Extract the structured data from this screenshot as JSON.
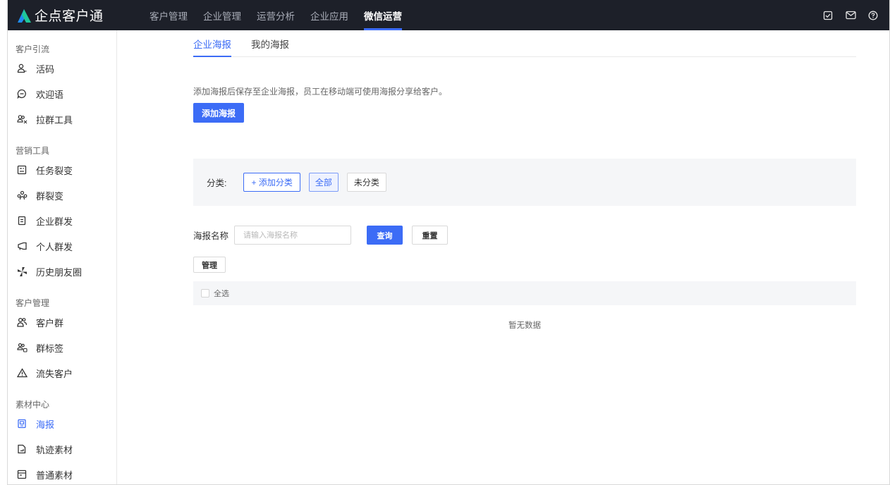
{
  "app": {
    "title": "企点客户通"
  },
  "topnav": {
    "items": [
      {
        "label": "客户管理"
      },
      {
        "label": "企业管理"
      },
      {
        "label": "运营分析"
      },
      {
        "label": "企业应用"
      },
      {
        "label": "微信运营"
      }
    ],
    "active_index": 4
  },
  "sidebar": {
    "groups": [
      {
        "label": "客户引流",
        "items": [
          {
            "label": "活码",
            "icon": "person-icon"
          },
          {
            "label": "欢迎语",
            "icon": "chat-bubble-icon"
          },
          {
            "label": "拉群工具",
            "icon": "group-add-icon"
          }
        ]
      },
      {
        "label": "营销工具",
        "items": [
          {
            "label": "任务裂变",
            "icon": "task-icon"
          },
          {
            "label": "群裂变",
            "icon": "group-icon"
          },
          {
            "label": "企业群发",
            "icon": "document-icon"
          },
          {
            "label": "个人群发",
            "icon": "megaphone-icon"
          },
          {
            "label": "历史朋友圈",
            "icon": "pinwheel-icon"
          }
        ]
      },
      {
        "label": "客户管理",
        "items": [
          {
            "label": "客户群",
            "icon": "customer-group-icon"
          },
          {
            "label": "群标签",
            "icon": "tag-group-icon"
          },
          {
            "label": "流失客户",
            "icon": "warning-icon"
          }
        ]
      },
      {
        "label": "素材中心",
        "items": [
          {
            "label": "海报",
            "icon": "poster-icon",
            "active": true
          },
          {
            "label": "轨迹素材",
            "icon": "track-icon"
          },
          {
            "label": "普通素材",
            "icon": "material-icon"
          }
        ]
      }
    ]
  },
  "main": {
    "tabs": [
      {
        "label": "企业海报"
      },
      {
        "label": "我的海报"
      }
    ],
    "active_tab": 0,
    "description": "添加海报后保存至企业海报，员工在移动端可使用海报分享给客户。",
    "add_button": "添加海报",
    "category": {
      "label": "分类:",
      "add_label": "+ 添加分类",
      "all_label": "全部",
      "uncategorized_label": "未分类"
    },
    "search": {
      "label": "海报名称",
      "placeholder": "请输入海报名称",
      "value": "",
      "query_label": "查询",
      "reset_label": "重置"
    },
    "manage_label": "管理",
    "select_all_label": "全选",
    "empty_text": "暂无数据"
  },
  "colors": {
    "accent": "#3c6cf6",
    "topbar": "#1d2029",
    "logo_blue": "#1f8cf0",
    "logo_green": "#1fc79a"
  }
}
